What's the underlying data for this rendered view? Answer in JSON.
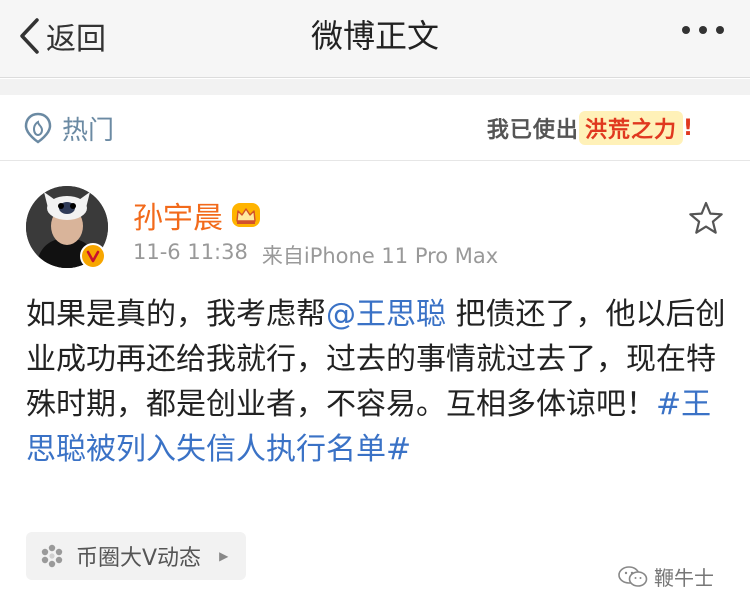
{
  "nav": {
    "back_label": "返回",
    "title": "微博正文"
  },
  "hotbar": {
    "tab_label": "热门",
    "slogan_prefix": "我已使出",
    "slogan_highlight": "洪荒之力",
    "slogan_suffix": "!"
  },
  "post": {
    "username": "孙宇晨",
    "date": "11-6 11:38",
    "source": "来自iPhone 11 Pro Max",
    "text_before_mention": "如果是真的，我考虑帮",
    "mention": "@王思聪",
    "text_after_mention": " 把债还了，他以后创业成功再还给我就行，过去的事情就过去了，现在特殊时期，都是创业者，不容易。互相多体谅吧！",
    "hashtag": "#王思聪被列入失信人执行名单#"
  },
  "source_chip": {
    "label": "币圈大V动态"
  },
  "watermark": {
    "label": "鞭牛士"
  },
  "colors": {
    "link": "#3a72c6",
    "username": "#f26a1b",
    "hot_icon": "#6b8aa3",
    "meta": "#999999"
  }
}
